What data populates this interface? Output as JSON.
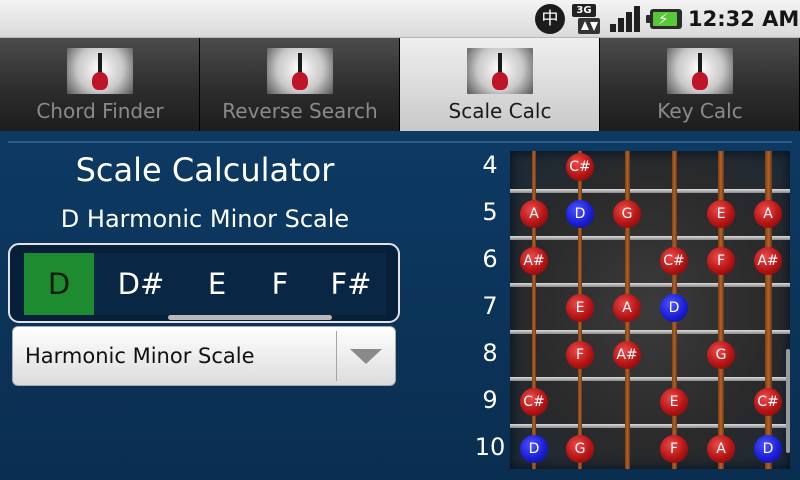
{
  "status": {
    "time": "12:32 AM",
    "network": "3G",
    "ime_char": "中"
  },
  "tabs": [
    {
      "label": "Chord Finder",
      "active": false
    },
    {
      "label": "Reverse Search",
      "active": false
    },
    {
      "label": "Scale Calc",
      "active": true
    },
    {
      "label": "Key Calc",
      "active": false
    }
  ],
  "scale": {
    "title": "Scale Calculator",
    "subtitle": "D Harmonic Minor Scale",
    "keys": [
      "D",
      "D#",
      "E",
      "F",
      "F#"
    ],
    "selected_key": "D",
    "scale_type": "Harmonic Minor Scale"
  },
  "fretboard": {
    "frets": [
      "4",
      "5",
      "6",
      "7",
      "8",
      "9",
      "10"
    ],
    "notes": [
      {
        "fret": 4,
        "string": 2,
        "note": "C#",
        "color": "red"
      },
      {
        "fret": 5,
        "string": 1,
        "note": "A",
        "color": "red"
      },
      {
        "fret": 5,
        "string": 2,
        "note": "D",
        "color": "blue"
      },
      {
        "fret": 5,
        "string": 3,
        "note": "G",
        "color": "red"
      },
      {
        "fret": 5,
        "string": 5,
        "note": "E",
        "color": "red"
      },
      {
        "fret": 5,
        "string": 6,
        "note": "A",
        "color": "red"
      },
      {
        "fret": 6,
        "string": 1,
        "note": "A#",
        "color": "red"
      },
      {
        "fret": 6,
        "string": 4,
        "note": "C#",
        "color": "red"
      },
      {
        "fret": 6,
        "string": 5,
        "note": "F",
        "color": "red"
      },
      {
        "fret": 6,
        "string": 6,
        "note": "A#",
        "color": "red"
      },
      {
        "fret": 7,
        "string": 2,
        "note": "E",
        "color": "red"
      },
      {
        "fret": 7,
        "string": 3,
        "note": "A",
        "color": "red"
      },
      {
        "fret": 7,
        "string": 4,
        "note": "D",
        "color": "blue"
      },
      {
        "fret": 8,
        "string": 2,
        "note": "F",
        "color": "red"
      },
      {
        "fret": 8,
        "string": 3,
        "note": "A#",
        "color": "red"
      },
      {
        "fret": 8,
        "string": 5,
        "note": "G",
        "color": "red"
      },
      {
        "fret": 9,
        "string": 1,
        "note": "C#",
        "color": "red"
      },
      {
        "fret": 9,
        "string": 4,
        "note": "E",
        "color": "red"
      },
      {
        "fret": 9,
        "string": 6,
        "note": "C#",
        "color": "red"
      },
      {
        "fret": 10,
        "string": 1,
        "note": "D",
        "color": "blue"
      },
      {
        "fret": 10,
        "string": 2,
        "note": "G",
        "color": "red"
      },
      {
        "fret": 10,
        "string": 4,
        "note": "F",
        "color": "red"
      },
      {
        "fret": 10,
        "string": 5,
        "note": "A",
        "color": "red"
      },
      {
        "fret": 10,
        "string": 6,
        "note": "D",
        "color": "blue"
      }
    ]
  },
  "colors": {
    "accent_green": "#1d8c30",
    "root_note_blue": "#1a1ed6",
    "scale_note_red": "#b51414",
    "background": "#0b2f52"
  }
}
